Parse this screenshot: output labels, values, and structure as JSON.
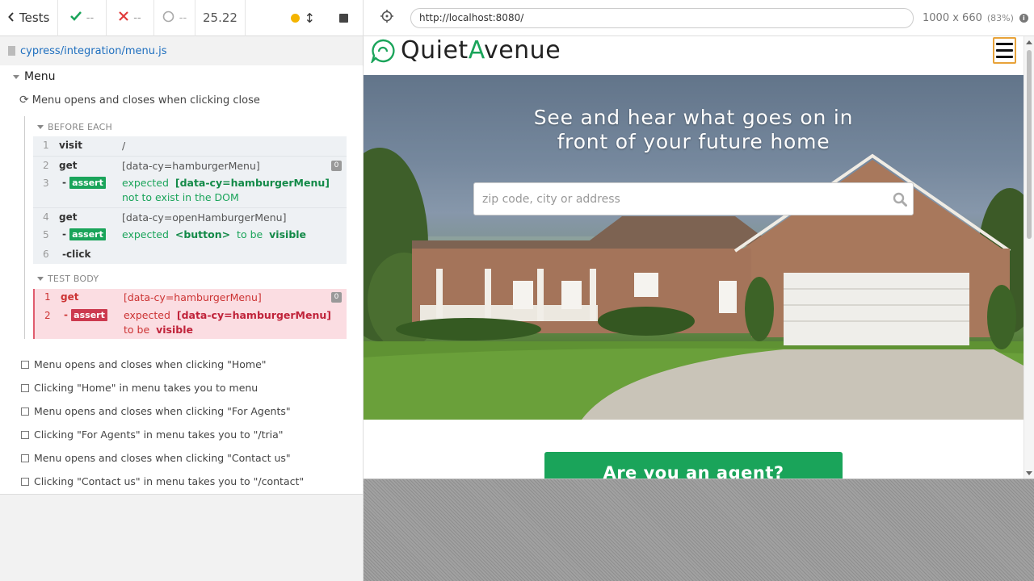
{
  "reporter": {
    "tests_label": "Tests",
    "passed": "--",
    "failed": "--",
    "pending": "--",
    "duration": "25.22",
    "spec_path": "cypress/integration/menu.js",
    "suite_title": "Menu",
    "current_test": "Menu opens and closes when clicking close",
    "before_each_label": "BEFORE EACH",
    "test_body_label": "TEST BODY",
    "before_each_commands": [
      {
        "num": "1",
        "name": "visit",
        "msg": "/"
      },
      {
        "num": "2",
        "name": "get",
        "msg": "[data-cy=hamburgerMenu]",
        "badge": "0"
      },
      {
        "num": "3",
        "name": "assert",
        "msg_prefix": "expected",
        "msg_subject": "[data-cy=hamburgerMenu]",
        "msg_suffix": "not to exist in the DOM"
      },
      {
        "num": "4",
        "name": "get",
        "msg": "[data-cy=openHamburgerMenu]"
      },
      {
        "num": "5",
        "name": "assert",
        "msg_prefix": "expected",
        "msg_subject": "<button>",
        "msg_mid": "to be",
        "msg_value": "visible"
      },
      {
        "num": "6",
        "name": "click"
      }
    ],
    "test_body_commands": [
      {
        "num": "1",
        "name": "get",
        "msg": "[data-cy=hamburgerMenu]",
        "badge": "0"
      },
      {
        "num": "2",
        "name": "assert",
        "msg_prefix": "expected",
        "msg_subject": "[data-cy=hamburgerMenu]",
        "msg_mid": "to be",
        "msg_value": "visible"
      }
    ],
    "other_tests": [
      "Menu opens and closes when clicking \"Home\"",
      "Clicking \"Home\" in menu takes you to menu",
      "Menu opens and closes when clicking \"For Agents\"",
      "Clicking \"For Agents\" in menu takes you to \"/tria\"",
      "Menu opens and closes when clicking \"Contact us\"",
      "Clicking \"Contact us\" in menu takes you to \"/contact\""
    ]
  },
  "aut": {
    "url": "http://localhost:8080/",
    "viewport_size": "1000 x 660",
    "viewport_scale": "(83%)"
  },
  "site": {
    "logo_pre": "Quiet",
    "logo_accent": "A",
    "logo_post": "venue",
    "hero_title_line1": "See and hear what goes on in",
    "hero_title_line2": "front of your future home",
    "search_placeholder": "zip code, city or address",
    "agent_button": "Are you an agent?"
  },
  "colors": {
    "accent_green": "#1aa45a",
    "fail_red": "#cc3a4f",
    "hamburger_outline": "#e8a33a",
    "link_blue": "#1f6fbf"
  }
}
